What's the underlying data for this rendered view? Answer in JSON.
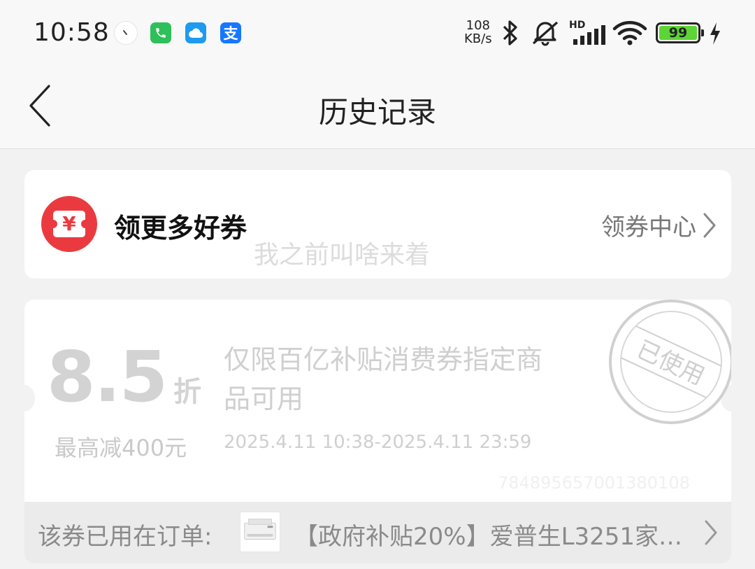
{
  "status_bar": {
    "time": "10:58",
    "net_speed_value": "108",
    "net_speed_unit": "KB/s",
    "signal_label": "HD",
    "battery_level": "99",
    "apps": [
      "dot-icon",
      "phone-icon",
      "cloud-icon",
      "alipay-icon"
    ],
    "alipay_glyph": "支"
  },
  "header": {
    "title": "历史记录",
    "back_icon": "chevron-left-icon"
  },
  "coupon_center_card": {
    "title": "领更多好券",
    "link_label": "领券中心",
    "logo_glyph": "¥",
    "accent_color": "#eb3a3f"
  },
  "watermark_text": "我之前叫啥来着",
  "coupon": {
    "discount_value": "8.5",
    "discount_unit": "折",
    "max_off": "最高减400元",
    "description": "仅限百亿补贴消费券指定商品可用",
    "validity": "2025.4.11 10:38-2025.4.11 23:59",
    "order_number": "7848956570013801​08",
    "stamp_text": "已使用",
    "used_label": "该券已用在订单:",
    "product_title": "【政府补贴20%】爱普生L3251家…"
  }
}
